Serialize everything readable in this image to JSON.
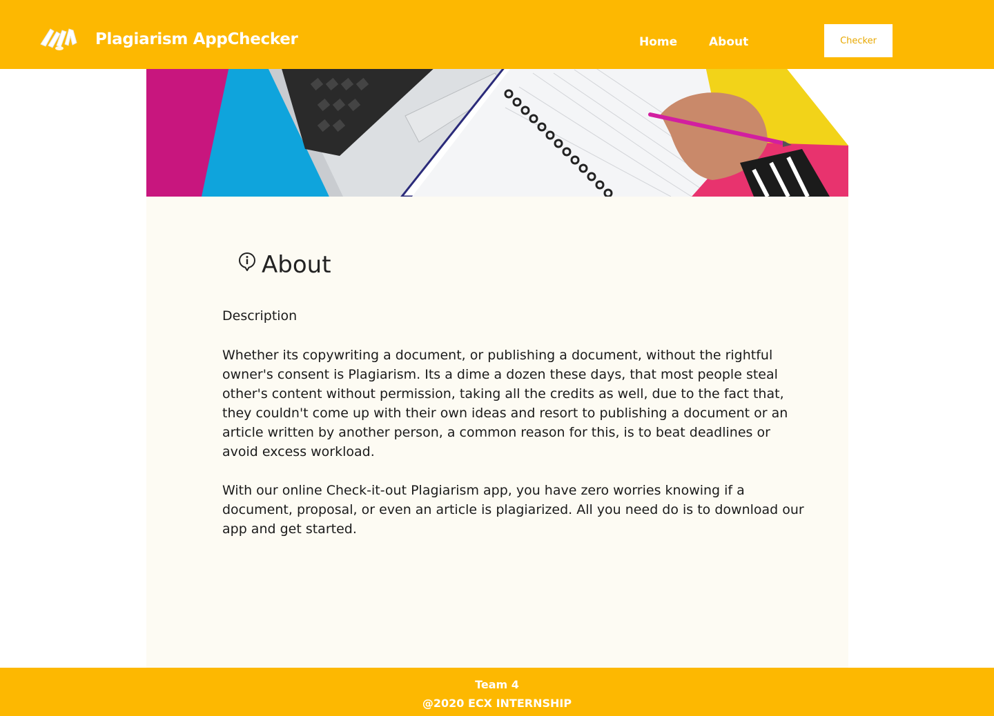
{
  "header": {
    "brand": "Plagiarism AppChecker",
    "nav": {
      "home": "Home",
      "about": "About"
    },
    "checker_button": "Checker",
    "logo_icon": "app-logo-icon",
    "background_color": "#fdb801"
  },
  "hero": {
    "image_subject": "laptop-notebook-pencil-illustration"
  },
  "about": {
    "icon": "info-icon",
    "title": "About",
    "description_label": "Description",
    "paragraph1": "Whether  its copywriting a document, or publishing  a document, without  the rightful owner's  consent is Plagiarism. Its a dime a dozen these days, that most people steal other's content without permission, taking  all the credits as well, due to the fact that, they couldn't  come up with their own ideas and resort to publishing  a document  or an article  written by another person, a common reason  for this, is to beat deadlines or avoid excess workload.",
    "paragraph2": "With our online  Check-it-out  Plagiarism app, you have zero worries knowing if a document, proposal, or even an article  is plagiarized.  All you need do is to download our app and get started."
  },
  "footer": {
    "team": "Team 4",
    "copyright": "@2020 ECX INTERNSHIP"
  }
}
